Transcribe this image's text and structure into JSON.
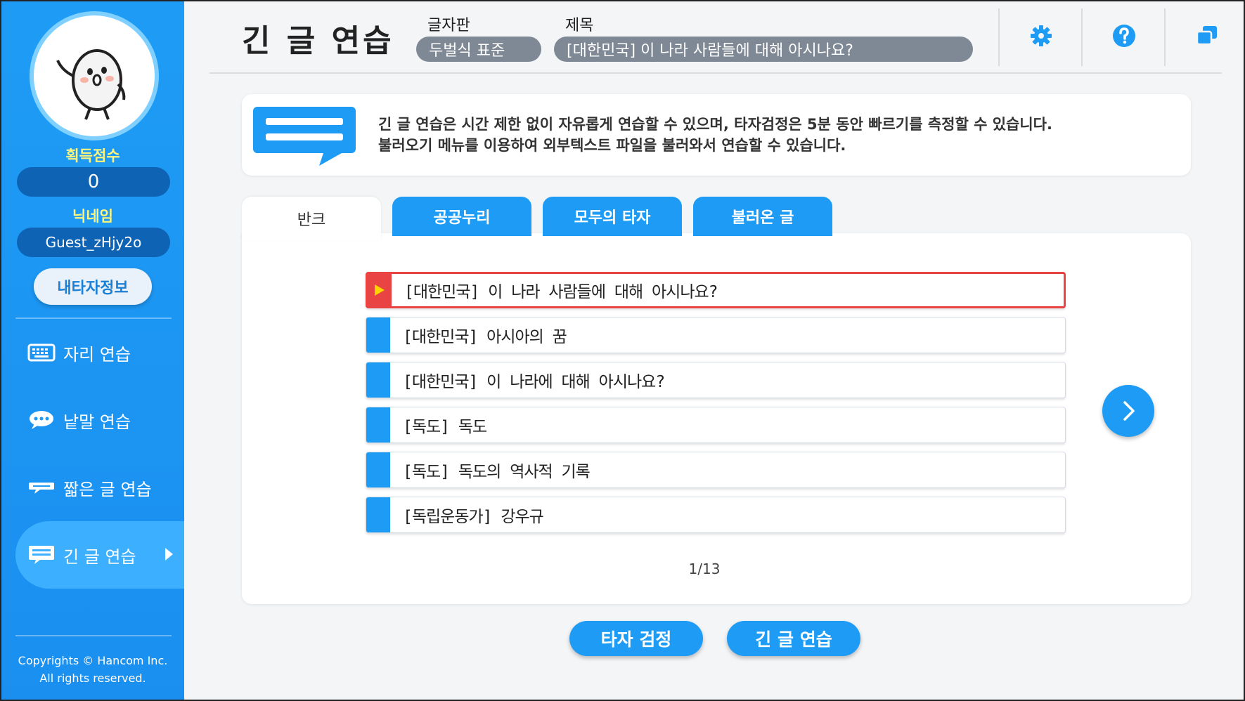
{
  "sidebar": {
    "score_label": "획득점수",
    "score_value": "0",
    "nickname_label": "닉네임",
    "nickname_value": "Guest_zHjy2o",
    "my_typing_info_button": "내타자정보",
    "nav": [
      {
        "label": "자리 연습",
        "icon": "keyboard-icon"
      },
      {
        "label": "낱말 연습",
        "icon": "speech-bubble-icon"
      },
      {
        "label": "짧은 글 연습",
        "icon": "short-text-icon"
      },
      {
        "label": "긴 글 연습",
        "icon": "long-text-icon"
      }
    ],
    "copyright_line1": "Copyrights © Hancom Inc.",
    "copyright_line2": "All rights reserved."
  },
  "header": {
    "title": "긴 글 연습",
    "keyboard_label": "글자판",
    "keyboard_value": "두벌식 표준",
    "subject_label": "제목",
    "subject_value": "[대한민국] 이 나라 사람들에 대해 아시나요?",
    "icons": [
      "gear-icon",
      "help-icon",
      "window-icon"
    ]
  },
  "info": {
    "line1": "긴 글 연습은 시간 제한 없이 자유롭게 연습할 수 있으며, 타자검정은 5분 동안 빠르기를 측정할 수 있습니다.",
    "line2": "불러오기 메뉴를 이용하여 외부텍스트 파일을 불러와서 연습할 수 있습니다."
  },
  "tabs": [
    {
      "label": "반크"
    },
    {
      "label": "공공누리"
    },
    {
      "label": "모두의 타자"
    },
    {
      "label": "불러온 글"
    }
  ],
  "list": [
    {
      "label": "[대한민국] 이 나라 사람들에 대해 아시나요?"
    },
    {
      "label": "[대한민국] 아시아의 꿈"
    },
    {
      "label": "[대한민국] 이 나라에 대해 아시나요?"
    },
    {
      "label": "[독도] 독도"
    },
    {
      "label": "[독도] 독도의 역사적 기록"
    },
    {
      "label": "[독립운동가] 강우규"
    }
  ],
  "pager": "1/13",
  "actions": {
    "typing_test": "타자 검정",
    "long_practice": "긴 글 연습"
  },
  "colors": {
    "accent": "#1e9cf5",
    "selected": "#e94343",
    "sidebar_dark": "#0f63b4",
    "label_yellow": "#fff57a"
  }
}
